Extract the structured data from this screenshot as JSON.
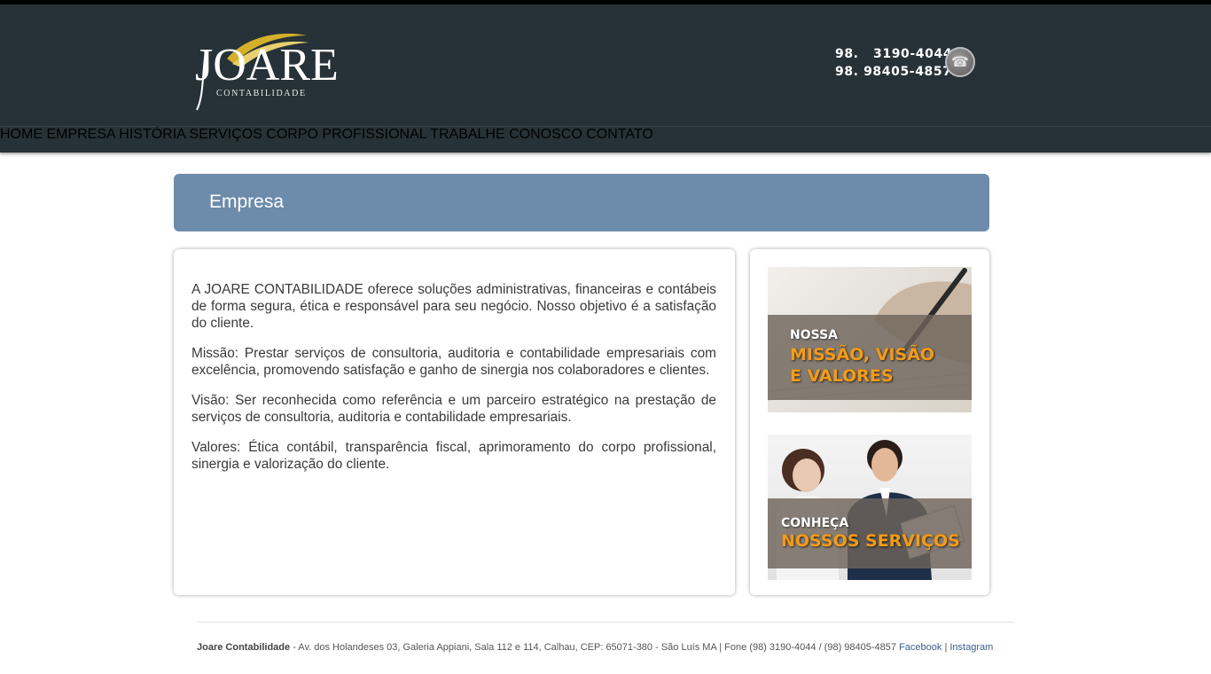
{
  "header": {
    "logo": {
      "word": "JOARE",
      "sub": "CONTABILIDADE"
    },
    "phones": [
      "98.   3190-4044",
      "98. 98405-4857"
    ],
    "phone_icon": "telephone-icon"
  },
  "nav": {
    "items": [
      "HOME",
      "EMPRESA",
      "HISTÓRIA",
      "SERVIÇOS",
      "CORPO PROFISSIONAL",
      "TRABALHE CONOSCO",
      "CONTATO"
    ]
  },
  "page": {
    "title": "Empresa"
  },
  "content": {
    "paragraphs": [
      "A JOARE CONTABILIDADE oferece soluções administrativas, financeiras e contábeis de forma segura, ética e responsável para seu negócio. Nosso objetivo é a satisfação do cliente.",
      "Missão: Prestar serviços de consultoria, auditoria e contabilidade empresariais com excelência, promovendo satisfação e ganho de sinergia nos colaboradores e clientes.",
      "Visão: Ser reconhecida como referência e um parceiro estratégico na prestação de serviços de consultoria, auditoria e contabilidade empresariais.",
      "Valores: Ética contábil, transparência fiscal, aprimoramento do corpo profissional, sinergia e valorização do cliente."
    ]
  },
  "sidebar": {
    "banner1": {
      "small": "NOSSA",
      "line1": "MISSÃO, VISÃO",
      "line2": "E VALORES"
    },
    "banner2": {
      "small": "CONHEÇA",
      "line1": "NOSSOS SERVIÇOS"
    }
  },
  "footer": {
    "company": "Joare Contabilidade",
    "address": " - Av. dos Holandeses 03, Galeria Appiani, Sala 112 e 114, Calhau, CEP: 65071-380 - São Luís MA | Fone (98) 3190-4044 / (98) 98405-4857 ",
    "facebook": "Facebook",
    "separator": " | ",
    "instagram": "Instagram"
  },
  "colors": {
    "header_bg": "#263238",
    "title_bar": "#6d8bab",
    "accent_orange": "#f39b17",
    "link": "#3a5f8a"
  }
}
